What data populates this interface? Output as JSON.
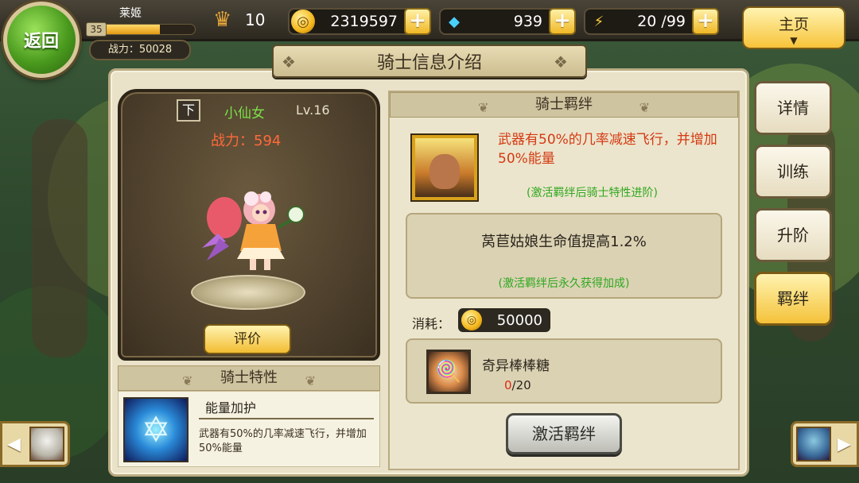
{
  "header": {
    "back_label": "返回",
    "player_name": "莱姬",
    "player_level": "35",
    "exp_fraction": 0.62,
    "power_label": "战力：50028",
    "rank_value": "10",
    "gold": "2319597",
    "gems": "939",
    "energy": "20 /99",
    "home_label": "主页"
  },
  "title": "骑士信息介绍",
  "hero": {
    "grade": "下",
    "name": "小仙女",
    "level": "Lv.16",
    "power": "战力：594",
    "rate_label": "评价"
  },
  "traits": {
    "header": "骑士特性",
    "name": "能量加护",
    "desc": "武器有50%的几率减速飞行，并增加50%能量"
  },
  "bond": {
    "header": "骑士羁绊",
    "effect": "武器有50%的几率减速飞行，并增加50%能量",
    "effect_note": "(激活羁绊后骑士特性进阶)",
    "bonus": "莴苣姑娘生命值提高1.2%",
    "bonus_note": "(激活羁绊后永久获得加成)",
    "cost_label": "消耗：",
    "cost_value": "50000",
    "item_name": "奇异棒棒糖",
    "item_have": "0",
    "item_need": "/20",
    "activate_label": "激活羁绊"
  },
  "side_tabs": [
    {
      "label": "详情"
    },
    {
      "label": "训练"
    },
    {
      "label": "升阶"
    },
    {
      "label": "羁绊"
    }
  ],
  "colors": {
    "accent_gold": "#f4c23a",
    "effect_red": "#d43a12",
    "note_green": "#2ea81e",
    "hero_name_green": "#7be04a"
  }
}
